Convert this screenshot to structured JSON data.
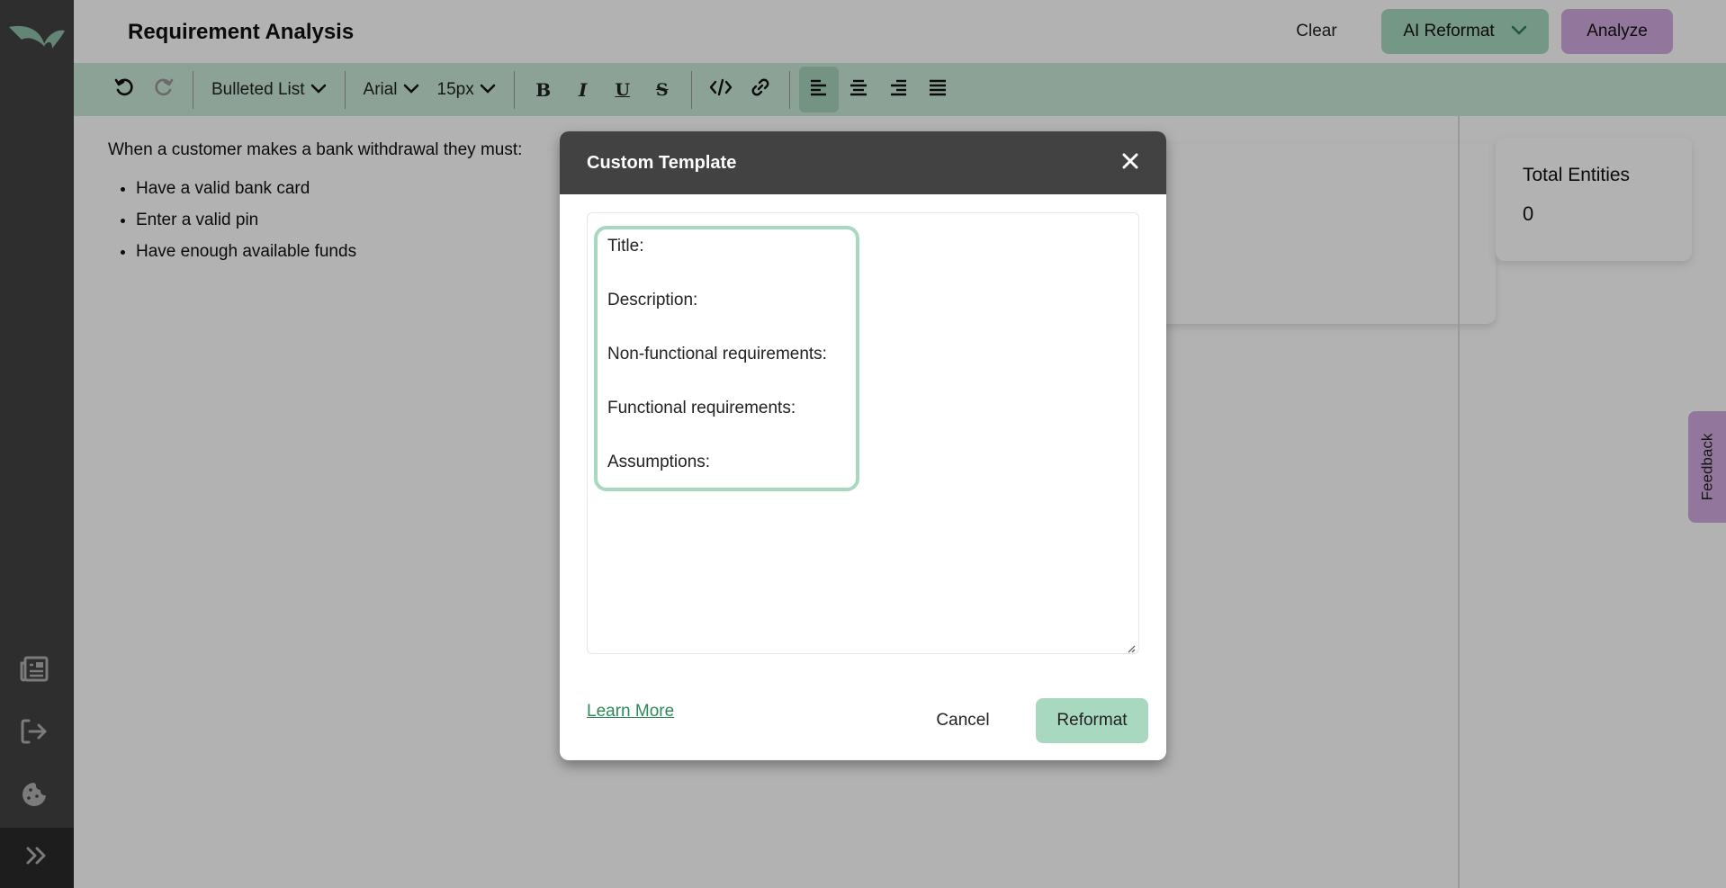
{
  "colors": {
    "sidebar": "#424242",
    "accent_green": "#a8d8c0",
    "accent_purple": "#d3a9e0",
    "toolbar": "#c9e8d8",
    "link": "#2e8b57"
  },
  "sidebar": {
    "logo": "leaf-logo",
    "items": [
      {
        "icon": "newspaper-icon",
        "name": "sidebar-item-docs"
      },
      {
        "icon": "logout-icon",
        "name": "sidebar-item-logout"
      },
      {
        "icon": "cookie-icon",
        "name": "sidebar-item-cookies"
      }
    ],
    "expand_icon": "double-chevron-right-icon"
  },
  "header": {
    "title": "Requirement Analysis",
    "clear_label": "Clear",
    "ai_reformat_label": "AI Reformat",
    "analyze_label": "Analyze"
  },
  "toolbar": {
    "block_type": "Bulleted List",
    "font_family": "Arial",
    "font_size": "15px",
    "buttons": [
      "undo",
      "redo",
      "bold",
      "italic",
      "underline",
      "strikethrough",
      "code",
      "link",
      "align-left",
      "align-center",
      "align-right",
      "align-justify"
    ],
    "active_alignment": "align-left"
  },
  "editor": {
    "intro": "When a customer makes a bank withdrawal they must:",
    "bullets": [
      "Have a valid bank card",
      "Enter a valid pin",
      "Have enough available funds"
    ]
  },
  "stats": {
    "total_entities_label": "Total Entities",
    "total_entities_value": "0"
  },
  "feedback": {
    "label": "Feedback"
  },
  "modal": {
    "title": "Custom Template",
    "template_lines": [
      "Title:",
      "Description:",
      "Non-functional requirements:",
      "Functional requirements:",
      "Assumptions:"
    ],
    "learn_more_label": "Learn More",
    "cancel_label": "Cancel",
    "submit_label": "Reformat"
  }
}
